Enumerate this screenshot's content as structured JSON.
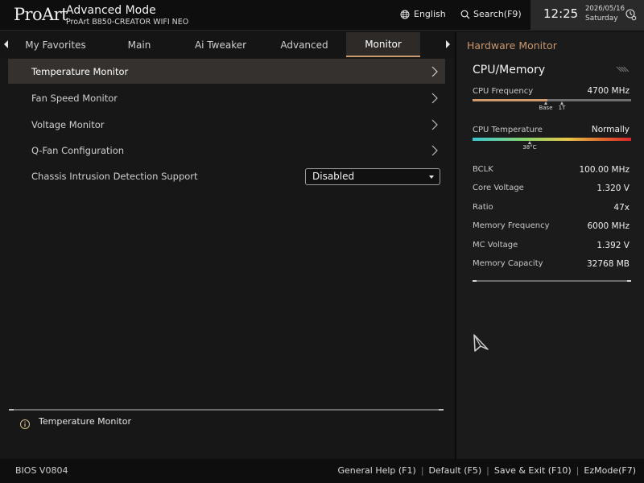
{
  "header": {
    "logo": "ProArt",
    "mode": "Advanced Mode",
    "board": "ProArt B850-CREATOR WIFI NEO",
    "language": "English",
    "search": "Search(F9)",
    "time": "12:25",
    "date": "2026/05/16",
    "day": "Saturday"
  },
  "tabs": [
    {
      "label": "My Favorites"
    },
    {
      "label": "Main"
    },
    {
      "label": "Ai Tweaker"
    },
    {
      "label": "Advanced"
    },
    {
      "label": "Monitor",
      "active": true
    }
  ],
  "menu": {
    "items": [
      {
        "label": "Temperature Monitor"
      },
      {
        "label": "Fan Speed Monitor"
      },
      {
        "label": "Voltage Monitor"
      },
      {
        "label": "Q-Fan Configuration"
      }
    ],
    "setting": {
      "label": "Chassis Intrusion Detection Support",
      "value": "Disabled"
    }
  },
  "help": {
    "text": "Temperature Monitor"
  },
  "hardware_monitor": {
    "title": "Hardware Monitor",
    "section": "CPU/Memory",
    "cpu_frequency": {
      "label": "CPU Frequency",
      "value": "4700 MHz",
      "fill_fraction": 0.47,
      "marker_base": "Base",
      "marker_1t": "1T"
    },
    "cpu_temperature": {
      "label": "CPU Temperature",
      "value": "Normally",
      "marker": "38°C",
      "marker_fraction": 0.36
    },
    "rows": [
      {
        "label": "BCLK",
        "value": "100.00 MHz"
      },
      {
        "label": "Core Voltage",
        "value": "1.320 V"
      },
      {
        "label": "Ratio",
        "value": "47x"
      },
      {
        "label": "Memory Frequency",
        "value": "6000 MHz"
      },
      {
        "label": "MC Voltage",
        "value": "1.392 V"
      },
      {
        "label": "Memory Capacity",
        "value": "32768 MB"
      }
    ]
  },
  "footer": {
    "bios_version": "BIOS V0804",
    "actions": [
      "General Help (F1)",
      "Default (F5)",
      "Save & Exit (F10)",
      "EzMode(F7)"
    ]
  },
  "colors": {
    "accent": "#c9966d",
    "selected_row": "#35312e",
    "background": "#151515"
  }
}
